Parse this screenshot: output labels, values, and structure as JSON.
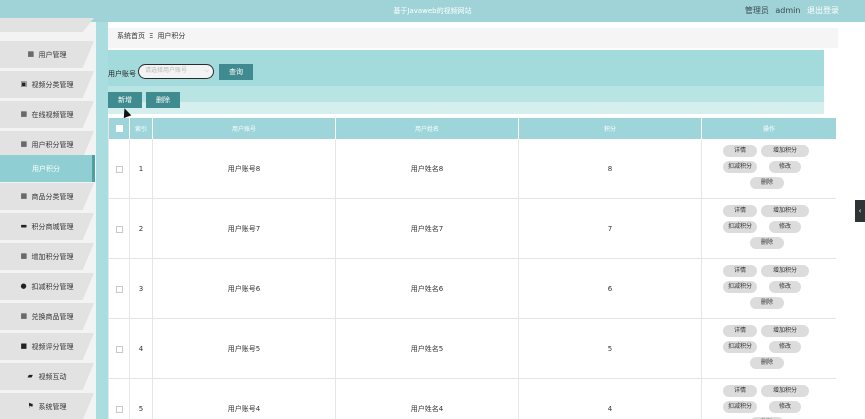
{
  "header": {
    "title": "基于Javaweb的视频网站",
    "role": "管理员",
    "username": "admin",
    "logout": "退出登录"
  },
  "sidebar": {
    "items": [
      {
        "label": "用户管理",
        "icon": "grid-icon"
      },
      {
        "label": "视频分类管理",
        "icon": "clipboard-icon"
      },
      {
        "label": "在线视频管理",
        "icon": "grid-icon"
      },
      {
        "label": "用户积分管理",
        "icon": "grid-icon"
      },
      {
        "label": "用户积分",
        "icon": "",
        "active": true
      },
      {
        "label": "商品分类管理",
        "icon": "grid-icon"
      },
      {
        "label": "积分商城管理",
        "icon": "shop-icon"
      },
      {
        "label": "增加积分管理",
        "icon": "grid-icon"
      },
      {
        "label": "扣减积分管理",
        "icon": "user-icon"
      },
      {
        "label": "兑换商品管理",
        "icon": "grid-icon"
      },
      {
        "label": "视频评分管理",
        "icon": "book-icon"
      },
      {
        "label": "视频互动",
        "icon": "chat-icon"
      },
      {
        "label": "系统管理",
        "icon": "flag-icon"
      }
    ]
  },
  "breadcrumb": {
    "home": "系统首页",
    "separator": "Ξ",
    "current": "用户积分"
  },
  "search": {
    "label": "用户账号",
    "placeholder": "请选择用户账号",
    "query_button": "查询",
    "add_button": "新增",
    "delete_button": "删除"
  },
  "table": {
    "headers": [
      "索引",
      "用户账号",
      "用户姓名",
      "积分",
      "操作"
    ],
    "rows": [
      {
        "index": "1",
        "account": "用户账号8",
        "name": "用户姓名8",
        "points": "8"
      },
      {
        "index": "2",
        "account": "用户账号7",
        "name": "用户姓名7",
        "points": "7"
      },
      {
        "index": "3",
        "account": "用户账号6",
        "name": "用户姓名6",
        "points": "6"
      },
      {
        "index": "4",
        "account": "用户账号5",
        "name": "用户姓名5",
        "points": "5"
      },
      {
        "index": "5",
        "account": "用户账号4",
        "name": "用户姓名4",
        "points": "4"
      }
    ],
    "ops": {
      "detail": "详情",
      "add_points": "增加积分",
      "sub_points": "扣减积分",
      "edit": "修改",
      "delete": "删除"
    }
  },
  "colors": {
    "accent": "#9fd3d8",
    "button": "#3f8b8f",
    "active_nav": "#8fcfd4"
  }
}
